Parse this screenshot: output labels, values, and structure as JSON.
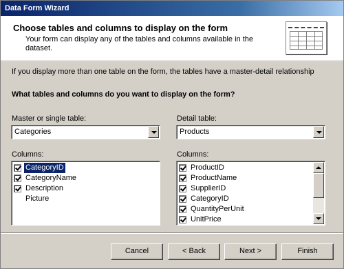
{
  "window": {
    "title": "Data Form Wizard"
  },
  "header": {
    "title": "Choose tables and columns to display on the form",
    "description": "Your form can display any of the tables and columns available in the dataset.",
    "icon": "table-form-icon"
  },
  "intro_text": "If you display more than one table on the form, the tables have a master-detail relationship",
  "question": "What tables and columns do you want to display on the form?",
  "master": {
    "label": "Master or single table:",
    "selected": "Categories",
    "columns_label": "Columns:",
    "columns": [
      {
        "name": "CategoryID",
        "checked": true
      },
      {
        "name": "CategoryName",
        "checked": true
      },
      {
        "name": "Description",
        "checked": true
      },
      {
        "name": "Picture",
        "checked": false
      }
    ]
  },
  "detail": {
    "label": "Detail table:",
    "selected": "Products",
    "columns_label": "Columns:",
    "columns": [
      {
        "name": "ProductID",
        "checked": true
      },
      {
        "name": "ProductName",
        "checked": true
      },
      {
        "name": "SupplierID",
        "checked": true
      },
      {
        "name": "CategoryID",
        "checked": true
      },
      {
        "name": "QuantityPerUnit",
        "checked": true
      },
      {
        "name": "UnitPrice",
        "checked": true
      }
    ]
  },
  "buttons": {
    "cancel": "Cancel",
    "back": "< Back",
    "next": "Next >",
    "finish": "Finish"
  }
}
